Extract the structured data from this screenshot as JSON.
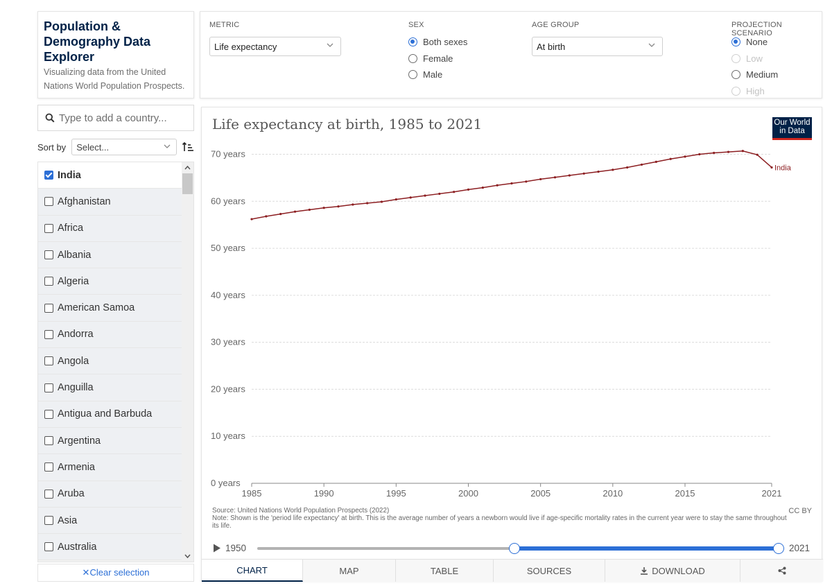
{
  "header": {
    "title": "Population & Demography Data Explorer",
    "subtitle": "Visualizing data from the United Nations World Population Prospects."
  },
  "controls": {
    "metric": {
      "label": "METRIC",
      "value": "Life expectancy"
    },
    "sex": {
      "label": "SEX",
      "options": [
        {
          "label": "Both sexes",
          "selected": true,
          "disabled": false
        },
        {
          "label": "Female",
          "selected": false,
          "disabled": false
        },
        {
          "label": "Male",
          "selected": false,
          "disabled": false
        }
      ]
    },
    "age_group": {
      "label": "AGE GROUP",
      "value": "At birth"
    },
    "projection": {
      "label": "PROJECTION SCENARIO",
      "options": [
        {
          "label": "None",
          "selected": true,
          "disabled": false
        },
        {
          "label": "Low",
          "selected": false,
          "disabled": true
        },
        {
          "label": "Medium",
          "selected": false,
          "disabled": false
        },
        {
          "label": "High",
          "selected": false,
          "disabled": true
        }
      ]
    }
  },
  "sidebar": {
    "search_placeholder": "Type to add a country...",
    "sort_label": "Sort by",
    "sort_value": "Select...",
    "entities": [
      {
        "name": "India",
        "checked": true
      },
      {
        "name": "Afghanistan",
        "checked": false
      },
      {
        "name": "Africa",
        "checked": false
      },
      {
        "name": "Albania",
        "checked": false
      },
      {
        "name": "Algeria",
        "checked": false
      },
      {
        "name": "American Samoa",
        "checked": false
      },
      {
        "name": "Andorra",
        "checked": false
      },
      {
        "name": "Angola",
        "checked": false
      },
      {
        "name": "Anguilla",
        "checked": false
      },
      {
        "name": "Antigua and Barbuda",
        "checked": false
      },
      {
        "name": "Argentina",
        "checked": false
      },
      {
        "name": "Armenia",
        "checked": false
      },
      {
        "name": "Aruba",
        "checked": false
      },
      {
        "name": "Asia",
        "checked": false
      },
      {
        "name": "Australia",
        "checked": false
      }
    ],
    "clear_label": "Clear selection"
  },
  "chart_header": {
    "title": "Life expectancy at birth, 1985 to 2021",
    "logo_text": "Our World in Data"
  },
  "chart_data": {
    "type": "line",
    "title": "Life expectancy at birth, 1985 to 2021",
    "xlabel": "",
    "ylabel": "",
    "xlim": [
      1985,
      2021
    ],
    "ylim": [
      0,
      70
    ],
    "y_ticks": [
      {
        "value": 0,
        "label": "0 years"
      },
      {
        "value": 10,
        "label": "10 years"
      },
      {
        "value": 20,
        "label": "20 years"
      },
      {
        "value": 30,
        "label": "30 years"
      },
      {
        "value": 40,
        "label": "40 years"
      },
      {
        "value": 50,
        "label": "50 years"
      },
      {
        "value": 60,
        "label": "60 years"
      },
      {
        "value": 70,
        "label": "70 years"
      }
    ],
    "x_ticks": [
      1985,
      1990,
      1995,
      2000,
      2005,
      2010,
      2015,
      2021
    ],
    "grid": true,
    "color": "#8c1e21",
    "series": [
      {
        "name": "India",
        "x": [
          1985,
          1986,
          1987,
          1988,
          1989,
          1990,
          1991,
          1992,
          1993,
          1994,
          1995,
          1996,
          1997,
          1998,
          1999,
          2000,
          2001,
          2002,
          2003,
          2004,
          2005,
          2006,
          2007,
          2008,
          2009,
          2010,
          2011,
          2012,
          2013,
          2014,
          2015,
          2016,
          2017,
          2018,
          2019,
          2020,
          2021
        ],
        "values": [
          56.2,
          56.8,
          57.3,
          57.8,
          58.2,
          58.6,
          58.9,
          59.3,
          59.6,
          59.9,
          60.4,
          60.8,
          61.2,
          61.6,
          62.0,
          62.5,
          62.9,
          63.4,
          63.8,
          64.2,
          64.7,
          65.1,
          65.5,
          65.9,
          66.3,
          66.7,
          67.2,
          67.8,
          68.4,
          69.0,
          69.5,
          70.0,
          70.3,
          70.5,
          70.7,
          69.9,
          67.2
        ]
      }
    ]
  },
  "footer": {
    "source": "Source: United Nations World Population Prospects (2022)",
    "note": "Note: Shown is the 'period life expectancy' at birth. This is the average number of years a newborn would live if age-specific mortality rates in the current year were to stay the same throughout its life.",
    "license": "CC BY"
  },
  "timeline": {
    "start_label": "1950",
    "end_label": "2021",
    "selected_start": 1985,
    "selected_end": 2021,
    "min": 1950,
    "max": 2021
  },
  "tabs": [
    {
      "label": "CHART",
      "active": true
    },
    {
      "label": "MAP",
      "active": false
    },
    {
      "label": "TABLE",
      "active": false
    },
    {
      "label": "SOURCES",
      "active": false
    },
    {
      "label": "DOWNLOAD",
      "active": false
    }
  ],
  "icons": {
    "search": "search-icon",
    "sort": "sort-ascending-icon",
    "play": "play-icon",
    "download": "download-icon",
    "share": "share-icon",
    "close": "close-icon"
  },
  "colors": {
    "accent": "#2c6fd6",
    "brand": "#002147",
    "line": "#8c1e21"
  }
}
